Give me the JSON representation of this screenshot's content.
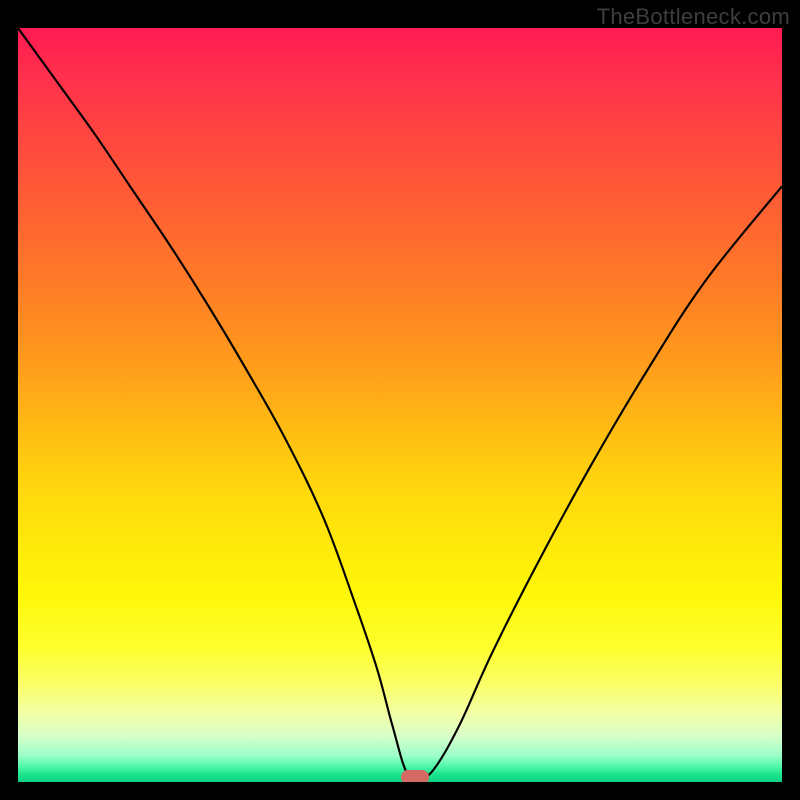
{
  "watermark": "TheBottleneck.com",
  "marker": {
    "x_pct": 51.9,
    "y_pct": 99.4
  },
  "chart_data": {
    "type": "line",
    "title": "",
    "xlabel": "",
    "ylabel": "",
    "xlim": [
      0,
      100
    ],
    "ylim": [
      0,
      100
    ],
    "grid": false,
    "legend": false,
    "series": [
      {
        "name": "bottleneck-curve",
        "x": [
          0,
          5,
          10,
          15,
          20,
          25,
          30,
          35,
          40,
          44,
          47,
          49,
          51,
          53,
          55,
          58,
          62,
          68,
          75,
          82,
          90,
          100
        ],
        "y": [
          100,
          93,
          86,
          78.5,
          71,
          63,
          54.5,
          45.5,
          35,
          24,
          15,
          7.5,
          1,
          0.5,
          2.5,
          8,
          17,
          29,
          42,
          54,
          66.5,
          79
        ]
      }
    ],
    "annotations": [
      {
        "type": "marker",
        "label": "optimal-point",
        "x": 51.9,
        "y": 0.6
      }
    ],
    "background_gradient": {
      "orientation": "vertical",
      "stops": [
        {
          "pos": 0.0,
          "color": "#ff1a52"
        },
        {
          "pos": 0.25,
          "color": "#ff6a30"
        },
        {
          "pos": 0.5,
          "color": "#ffc010"
        },
        {
          "pos": 0.75,
          "color": "#fff70a"
        },
        {
          "pos": 0.92,
          "color": "#f1ffa6"
        },
        {
          "pos": 1.0,
          "color": "#0fd183"
        }
      ]
    }
  }
}
